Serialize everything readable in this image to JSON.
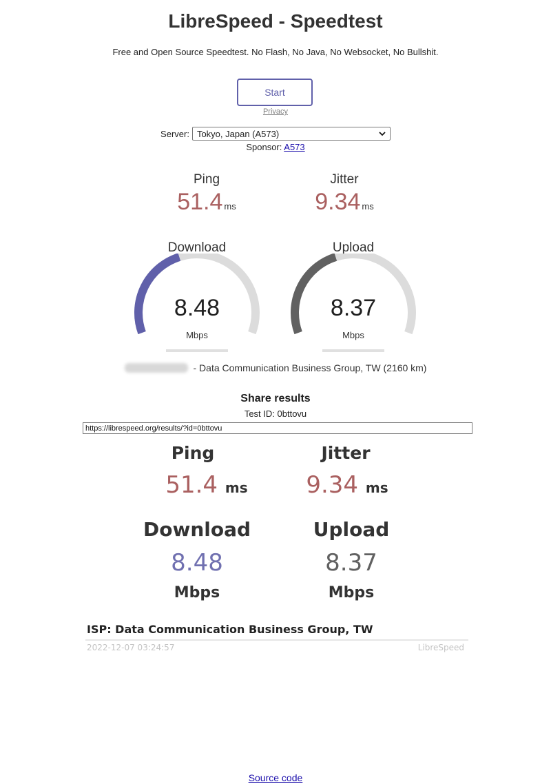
{
  "header": {
    "title": "LibreSpeed - Speedtest",
    "subtitle": "Free and Open Source Speedtest. No Flash, No Java, No Websocket, No Bullshit."
  },
  "controls": {
    "start_label": "Start",
    "privacy_label": "Privacy",
    "server_label": "Server:",
    "server_selected": "Tokyo, Japan (A573)",
    "sponsor_label": "Sponsor:",
    "sponsor_link": "A573"
  },
  "metrics": {
    "ping_label": "Ping",
    "ping_value": "51.4",
    "ping_unit": "ms",
    "jitter_label": "Jitter",
    "jitter_value": "9.34",
    "jitter_unit": "ms"
  },
  "gauges": {
    "download_label": "Download",
    "download_value": "8.48",
    "download_unit": "Mbps",
    "download_fill_fraction": 0.42,
    "download_color": "#6060AA",
    "upload_label": "Upload",
    "upload_value": "8.37",
    "upload_unit": "Mbps",
    "upload_fill_fraction": 0.42,
    "upload_color": "#616161"
  },
  "ip_info": "- Data Communication Business Group, TW (2160 km)",
  "share": {
    "title": "Share results",
    "test_id": "Test ID: 0bttovu",
    "url": "https://librespeed.org/results/?id=0bttovu"
  },
  "result_image": {
    "ping_label": "Ping",
    "ping_value": "51.4",
    "ping_unit": "ms",
    "jitter_label": "Jitter",
    "jitter_value": "9.34",
    "jitter_unit": "ms",
    "download_label": "Download",
    "download_value": "8.48",
    "download_unit": "Mbps",
    "upload_label": "Upload",
    "upload_value": "8.37",
    "upload_unit": "Mbps",
    "isp": "ISP: Data Communication Business Group, TW",
    "timestamp": "2022-12-07 03:24:57",
    "brand": "LibreSpeed",
    "ping_color": "#AA6060",
    "download_color": "#7070B0",
    "upload_color": "#616161"
  },
  "footer": {
    "source_label": "Source code"
  }
}
